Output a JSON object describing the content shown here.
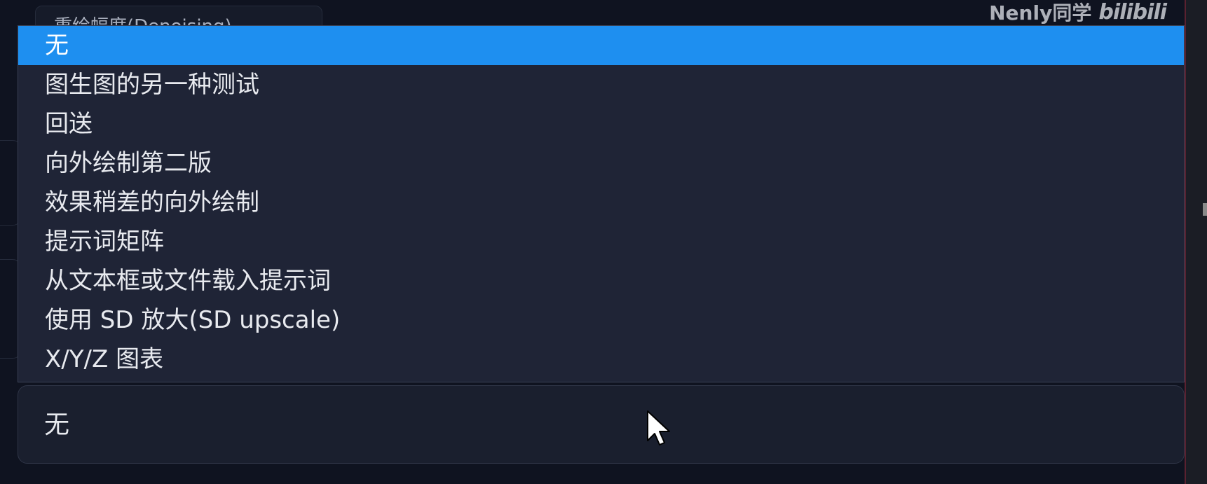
{
  "top_field": {
    "label": "重绘幅度(Denoising)"
  },
  "watermark": {
    "author": "Nenly同学",
    "logo": "bilibili"
  },
  "dropdown": {
    "options": [
      "无",
      "图生图的另一种测试",
      "回送",
      "向外绘制第二版",
      "效果稍差的向外绘制",
      "提示词矩阵",
      "从文本框或文件载入提示词",
      "使用 SD 放大(SD upscale)",
      "X/Y/Z 图表"
    ],
    "selected_value": "无"
  },
  "colors": {
    "highlight": "#1e8ff0",
    "background": "#0f1320",
    "list_background": "#1f2436"
  },
  "icons": {
    "cursor": "mouse-pointer-icon"
  }
}
